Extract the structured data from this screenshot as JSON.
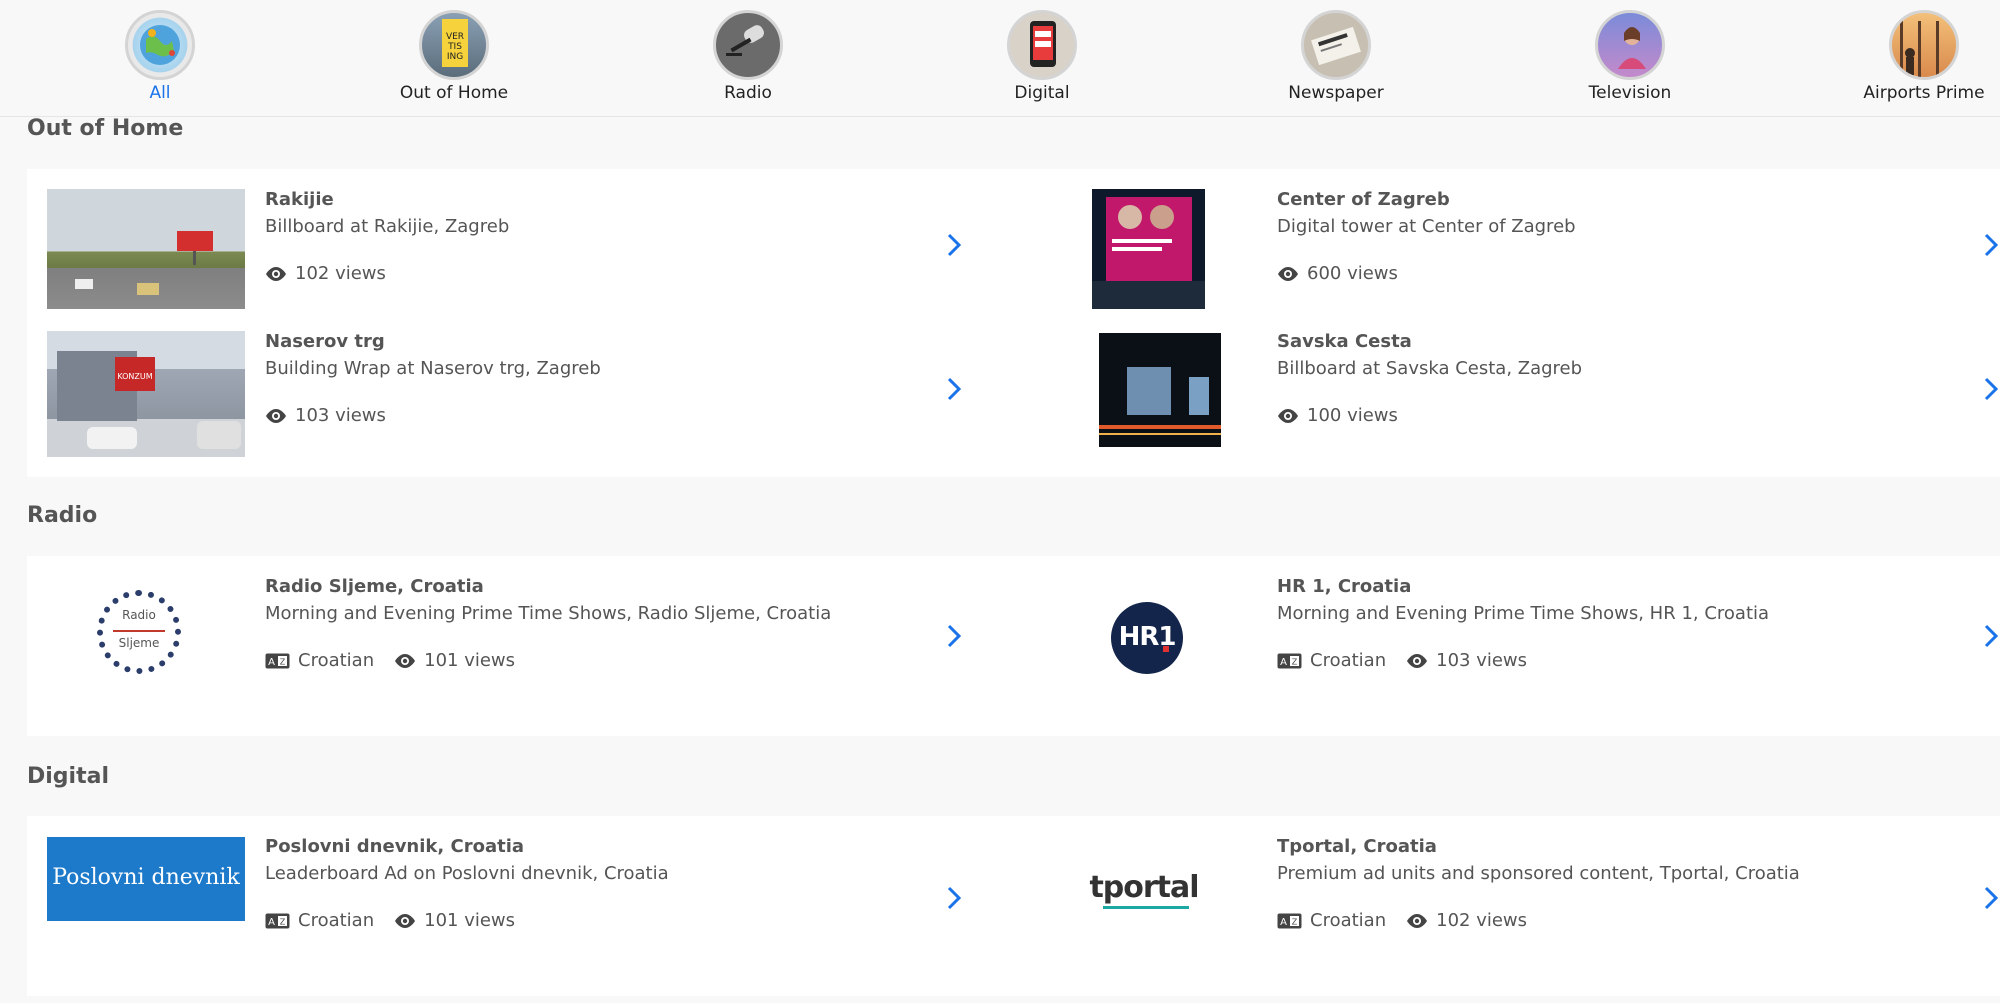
{
  "nav": {
    "items": [
      {
        "label": "All",
        "icon": "globe-icon"
      },
      {
        "label": "Out of Home",
        "icon": "billboard-icon"
      },
      {
        "label": "Radio",
        "icon": "microphone-icon"
      },
      {
        "label": "Digital",
        "icon": "smartphone-icon"
      },
      {
        "label": "Newspaper",
        "icon": "newspaper-icon"
      },
      {
        "label": "Television",
        "icon": "television-icon"
      },
      {
        "label": "Airports Prime",
        "icon": "airport-icon"
      }
    ],
    "active_label": "All"
  },
  "sections": {
    "ooh": {
      "title": "Out of Home",
      "cards": [
        {
          "title": "Rakijie",
          "subtitle": "Billboard at Rakijie, Zagreb",
          "views": "102 views"
        },
        {
          "title": "Center of Zagreb",
          "subtitle": "Digital tower at Center of Zagreb",
          "views": "600 views"
        },
        {
          "title": "Naserov trg",
          "subtitle": "Building Wrap at Naserov trg, Zagreb",
          "views": "103 views"
        },
        {
          "title": "Savska Cesta",
          "subtitle": "Billboard at Savska Cesta, Zagreb",
          "views": "100 views"
        }
      ]
    },
    "radio": {
      "title": "Radio",
      "cards": [
        {
          "title": "Radio Sljeme, Croatia",
          "subtitle": "Morning and Evening Prime Time Shows, Radio Sljeme, Croatia",
          "language": "Croatian",
          "views": "101 views",
          "logo_text_1": "Radio",
          "logo_text_2": "Sljeme"
        },
        {
          "title": "HR 1, Croatia",
          "subtitle": "Morning and Evening Prime Time Shows, HR 1, Croatia",
          "language": "Croatian",
          "views": "103 views",
          "logo_text": "HR1"
        }
      ]
    },
    "digital": {
      "title": "Digital",
      "cards": [
        {
          "title": "Poslovni dnevnik, Croatia",
          "subtitle": "Leaderboard Ad on Poslovni dnevnik, Croatia",
          "language": "Croatian",
          "views": "101 views",
          "logo_text": "Poslovni dnevnik"
        },
        {
          "title": "Tportal, Croatia",
          "subtitle": "Premium ad units and sponsored content, Tportal, Croatia",
          "language": "Croatian",
          "views": "102 views",
          "logo_text": "tportal"
        }
      ]
    }
  },
  "colors": {
    "accent": "#1a73e8",
    "text_muted": "#555555",
    "panel_bg": "#ffffff",
    "page_bg": "#f8f8f8"
  }
}
